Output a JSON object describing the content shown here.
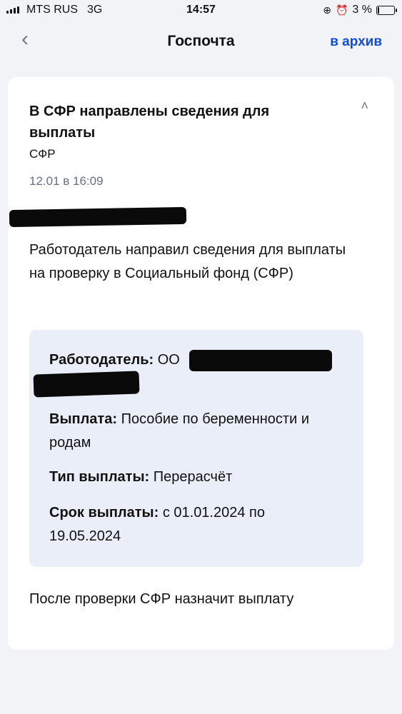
{
  "status_bar": {
    "carrier": "MTS RUS",
    "network": "3G",
    "time": "14:57",
    "battery": "3 %",
    "battery_level": 0.03
  },
  "nav": {
    "title": "Госпочта",
    "archive_label": "в архив"
  },
  "message": {
    "title": "В СФР направлены сведения для выплаты",
    "sender": "СФР",
    "date": "12.01 в 16:09",
    "intro": "Работодатель направил сведения для выплаты на проверку в Социальный фонд (СФР)",
    "details": {
      "employer_label": "Работодатель:",
      "employer_value": "ОО",
      "payment_label": "Выплата:",
      "payment_value": "Пособие по беременности и родам",
      "type_label": "Тип выплаты:",
      "type_value": "Перерасчёт",
      "period_label": "Срок выплаты:",
      "period_value": "с 01.01.2024 по 19.05.2024"
    },
    "outro": "После проверки СФР назначит выплату"
  }
}
